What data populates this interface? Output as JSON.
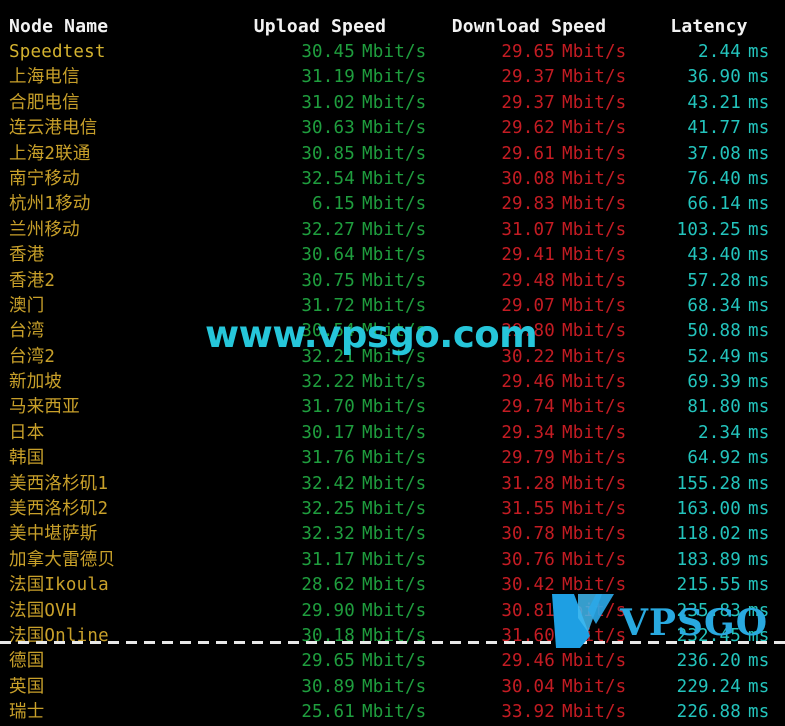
{
  "header": {
    "node_name": "Node Name",
    "upload_speed": "Upload Speed",
    "download_speed": "Download Speed",
    "latency": "Latency"
  },
  "units": {
    "speed": "Mbit/s",
    "latency": "ms"
  },
  "colors": {
    "background": "#000000",
    "header_text": "#f2f2f2",
    "node_name": "#c8a02a",
    "upload": "#1f9e3e",
    "download": "#c41c23",
    "latency": "#23c4bd",
    "watermark": "#26c6da",
    "logo": "#29a9e0"
  },
  "watermark": {
    "text": "www.vpsgo.com",
    "logo_text": "VPSGO",
    "logo_mark": "v-logo-icon"
  },
  "rows": [
    {
      "name": "Speedtest",
      "upload": "30.45",
      "download": "29.65",
      "latency": "2.44"
    },
    {
      "name": "上海电信",
      "upload": "31.19",
      "download": "29.37",
      "latency": "36.90"
    },
    {
      "name": "合肥电信",
      "upload": "31.02",
      "download": "29.37",
      "latency": "43.21"
    },
    {
      "name": "连云港电信",
      "upload": "30.63",
      "download": "29.62",
      "latency": "41.77"
    },
    {
      "name": "上海2联通",
      "upload": "30.85",
      "download": "29.61",
      "latency": "37.08"
    },
    {
      "name": "南宁移动",
      "upload": "32.54",
      "download": "30.08",
      "latency": "76.40"
    },
    {
      "name": "杭州1移动",
      "upload": "6.15",
      "download": "29.83",
      "latency": "66.14"
    },
    {
      "name": "兰州移动",
      "upload": "32.27",
      "download": "31.07",
      "latency": "103.25"
    },
    {
      "name": "香港",
      "upload": "30.64",
      "download": "29.41",
      "latency": "43.40"
    },
    {
      "name": "香港2",
      "upload": "30.75",
      "download": "29.48",
      "latency": "57.28"
    },
    {
      "name": "澳门",
      "upload": "31.72",
      "download": "29.07",
      "latency": "68.34"
    },
    {
      "name": "台湾",
      "upload": "30.54",
      "download": "29.80",
      "latency": "50.88"
    },
    {
      "name": "台湾2",
      "upload": "32.21",
      "download": "30.22",
      "latency": "52.49"
    },
    {
      "name": "新加坡",
      "upload": "32.22",
      "download": "29.46",
      "latency": "69.39"
    },
    {
      "name": "马来西亚",
      "upload": "31.70",
      "download": "29.74",
      "latency": "81.80"
    },
    {
      "name": "日本",
      "upload": "30.17",
      "download": "29.34",
      "latency": "2.34"
    },
    {
      "name": "韩国",
      "upload": "31.76",
      "download": "29.79",
      "latency": "64.92"
    },
    {
      "name": "美西洛杉矶1",
      "upload": "32.42",
      "download": "31.28",
      "latency": "155.28"
    },
    {
      "name": "美西洛杉矶2",
      "upload": "32.25",
      "download": "31.55",
      "latency": "163.00"
    },
    {
      "name": "美中堪萨斯",
      "upload": "32.32",
      "download": "30.78",
      "latency": "118.02"
    },
    {
      "name": "加拿大雷德贝",
      "upload": "31.17",
      "download": "30.76",
      "latency": "183.89"
    },
    {
      "name": "法国Ikoula",
      "upload": "28.62",
      "download": "30.42",
      "latency": "215.55"
    },
    {
      "name": "法国OVH",
      "upload": "29.90",
      "download": "30.81",
      "latency": "235.83"
    },
    {
      "name": "法国Online",
      "upload": "30.18",
      "download": "31.60",
      "latency": "232.45"
    },
    {
      "name": "德国",
      "upload": "29.65",
      "download": "29.46",
      "latency": "236.20"
    },
    {
      "name": "英国",
      "upload": "30.89",
      "download": "30.04",
      "latency": "229.24"
    },
    {
      "name": "瑞士",
      "upload": "25.61",
      "download": "33.92",
      "latency": "226.88"
    }
  ]
}
